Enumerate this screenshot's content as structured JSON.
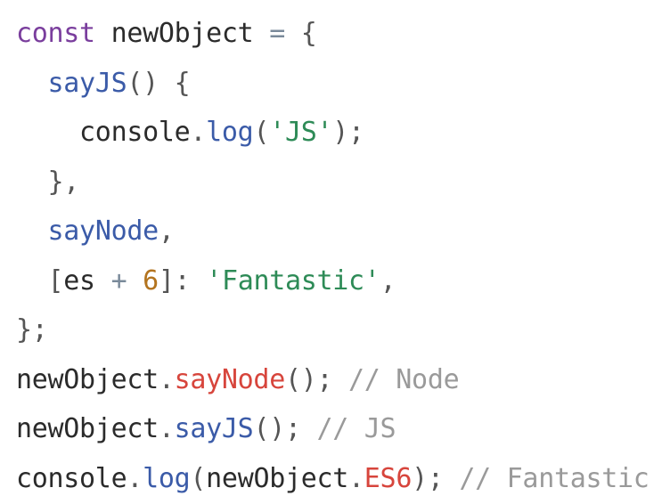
{
  "code_lines": [
    [
      {
        "t": "keyword",
        "v": "const"
      },
      {
        "t": "plain",
        "v": " newObject "
      },
      {
        "t": "op",
        "v": "="
      },
      {
        "t": "plain",
        "v": " "
      },
      {
        "t": "punct",
        "v": "{"
      }
    ],
    [
      {
        "t": "plain",
        "v": "  "
      },
      {
        "t": "method",
        "v": "sayJS"
      },
      {
        "t": "punct",
        "v": "() {"
      }
    ],
    [
      {
        "t": "plain",
        "v": "    console"
      },
      {
        "t": "punct",
        "v": "."
      },
      {
        "t": "method",
        "v": "log"
      },
      {
        "t": "punct",
        "v": "("
      },
      {
        "t": "string",
        "v": "'JS'"
      },
      {
        "t": "punct",
        "v": ");"
      }
    ],
    [
      {
        "t": "plain",
        "v": "  "
      },
      {
        "t": "punct",
        "v": "},"
      }
    ],
    [
      {
        "t": "plain",
        "v": "  "
      },
      {
        "t": "prop",
        "v": "sayNode"
      },
      {
        "t": "punct",
        "v": ","
      }
    ],
    [
      {
        "t": "plain",
        "v": "  "
      },
      {
        "t": "punct",
        "v": "["
      },
      {
        "t": "plain",
        "v": "es "
      },
      {
        "t": "op",
        "v": "+"
      },
      {
        "t": "plain",
        "v": " "
      },
      {
        "t": "number",
        "v": "6"
      },
      {
        "t": "punct",
        "v": "]: "
      },
      {
        "t": "string",
        "v": "'Fantastic'"
      },
      {
        "t": "punct",
        "v": ","
      }
    ],
    [
      {
        "t": "punct",
        "v": "};"
      }
    ],
    [
      {
        "t": "plain",
        "v": "newObject"
      },
      {
        "t": "punct",
        "v": "."
      },
      {
        "t": "call",
        "v": "sayNode"
      },
      {
        "t": "punct",
        "v": "(); "
      },
      {
        "t": "comment",
        "v": "// Node"
      }
    ],
    [
      {
        "t": "plain",
        "v": "newObject"
      },
      {
        "t": "punct",
        "v": "."
      },
      {
        "t": "method",
        "v": "sayJS"
      },
      {
        "t": "punct",
        "v": "(); "
      },
      {
        "t": "comment",
        "v": "// JS"
      }
    ],
    [
      {
        "t": "plain",
        "v": "console"
      },
      {
        "t": "punct",
        "v": "."
      },
      {
        "t": "method",
        "v": "log"
      },
      {
        "t": "punct",
        "v": "("
      },
      {
        "t": "plain",
        "v": "newObject"
      },
      {
        "t": "punct",
        "v": "."
      },
      {
        "t": "call",
        "v": "ES6"
      },
      {
        "t": "punct",
        "v": "); "
      },
      {
        "t": "comment",
        "v": "// Fantastic"
      }
    ]
  ]
}
